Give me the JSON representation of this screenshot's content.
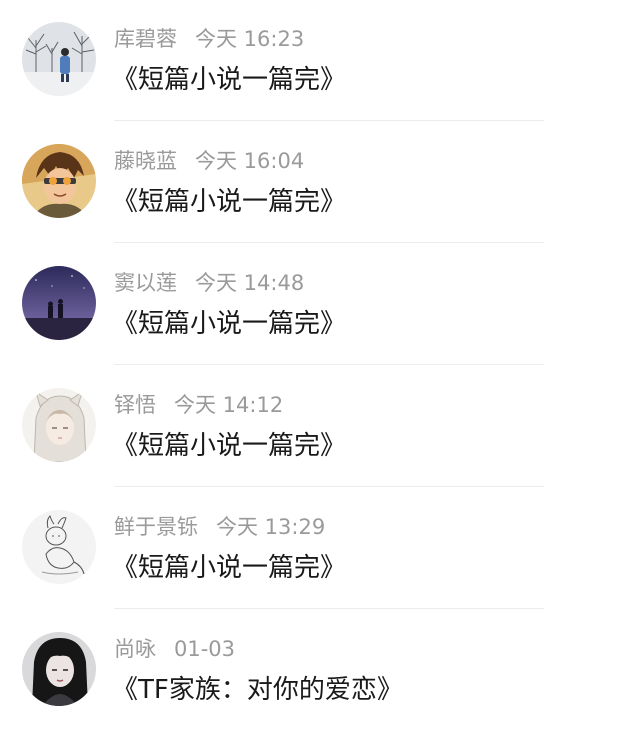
{
  "feed": {
    "items": [
      {
        "name": "库碧蓉",
        "time": "今天 16:23",
        "title": "《短篇小说一篇完》",
        "avatar": "avatar-winter-trees-person"
      },
      {
        "name": "藤晓蓝",
        "time": "今天 16:04",
        "title": "《短篇小说一篇完》",
        "avatar": "avatar-anime-boy-goggles"
      },
      {
        "name": "窦以莲",
        "time": "今天 14:48",
        "title": "《短篇小说一篇完》",
        "avatar": "avatar-night-sky-figures"
      },
      {
        "name": "铎悟",
        "time": "今天 14:12",
        "title": "《短篇小说一篇完》",
        "avatar": "avatar-anime-girl-hood"
      },
      {
        "name": "鲜于景铄",
        "time": "今天 13:29",
        "title": "《短篇小说一篇完》",
        "avatar": "avatar-sketch-cat"
      },
      {
        "name": "尚咏",
        "time": "01-03",
        "title": "《TF家族：对你的爱恋》",
        "avatar": "avatar-girl-dark-hair"
      }
    ]
  }
}
